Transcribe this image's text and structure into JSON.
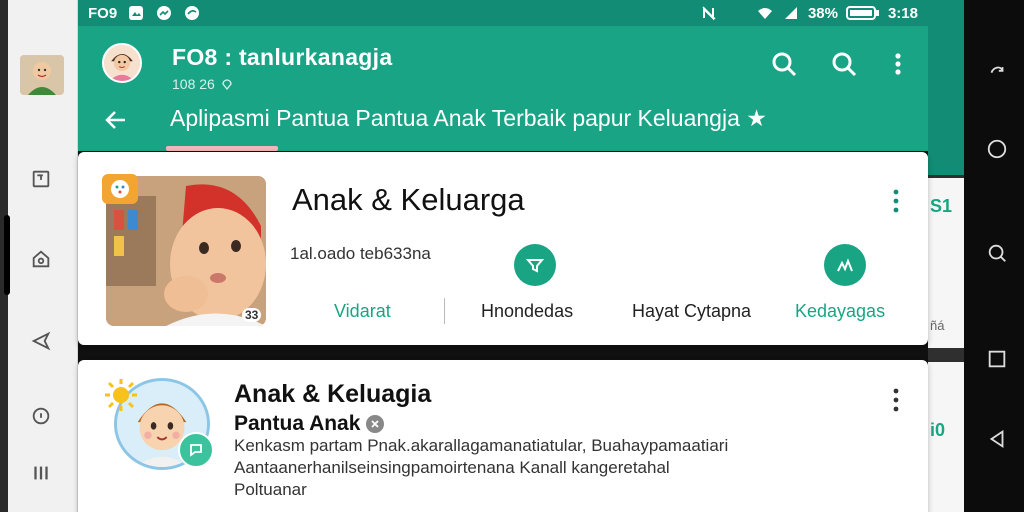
{
  "colors": {
    "status_bar": "#128c74",
    "app_bar": "#1aa486",
    "accent": "#19a583",
    "card_bg": "#ffffff",
    "rail_bg": "#f1f1f1"
  },
  "status_bar": {
    "left_text": "FO9",
    "left_icons": [
      "gallery-icon",
      "messenger-icon",
      "bird-icon"
    ],
    "battery_text": "38%",
    "time": "3:18",
    "right_icons": [
      "no-disturb-icon",
      "wifi-icon",
      "signal-icon",
      "battery-icon"
    ]
  },
  "app_bar": {
    "title": "FO8 : tanlurkanagja",
    "subtitle": "108 26",
    "header_text": "Aplipasmi Pantua Pantua Anak Terbaik papur Keluangja ★",
    "icons": [
      "search-icon",
      "search-icon",
      "more-vertical-icon"
    ]
  },
  "left_rail": {
    "icons": [
      "avatar",
      "folder-icon",
      "home-icon",
      "send-icon",
      "info-icon",
      "menu-icon"
    ]
  },
  "card1": {
    "title": "Anak & Keluarga",
    "subtitle": "1al.oado teb633na",
    "duration": "33",
    "actions": [
      {
        "label": "Vidarat",
        "icon": "",
        "color": "#19a583"
      },
      {
        "label": "Hnondedas",
        "icon": "filter-icon",
        "color": "#222"
      },
      {
        "label": "Hayat Cytapna",
        "icon": "",
        "color": "#222"
      },
      {
        "label": "Kedayagas",
        "icon": "people-icon",
        "color": "#19a583"
      }
    ]
  },
  "card2": {
    "title": "Anak & Keluagia",
    "subtitle": "Pantua Anak",
    "body_line1": "Kenkasm partam Pnak.akarallagamanatiatular, Buahaypamaatiari",
    "body_line2": "Aantaanerhanilseinsingpamoirtenana Kanall kangeretahal",
    "body_line3": "Poltuanar"
  },
  "peek": {
    "text1": "S1",
    "text2": "ñá",
    "text3": "i0"
  }
}
